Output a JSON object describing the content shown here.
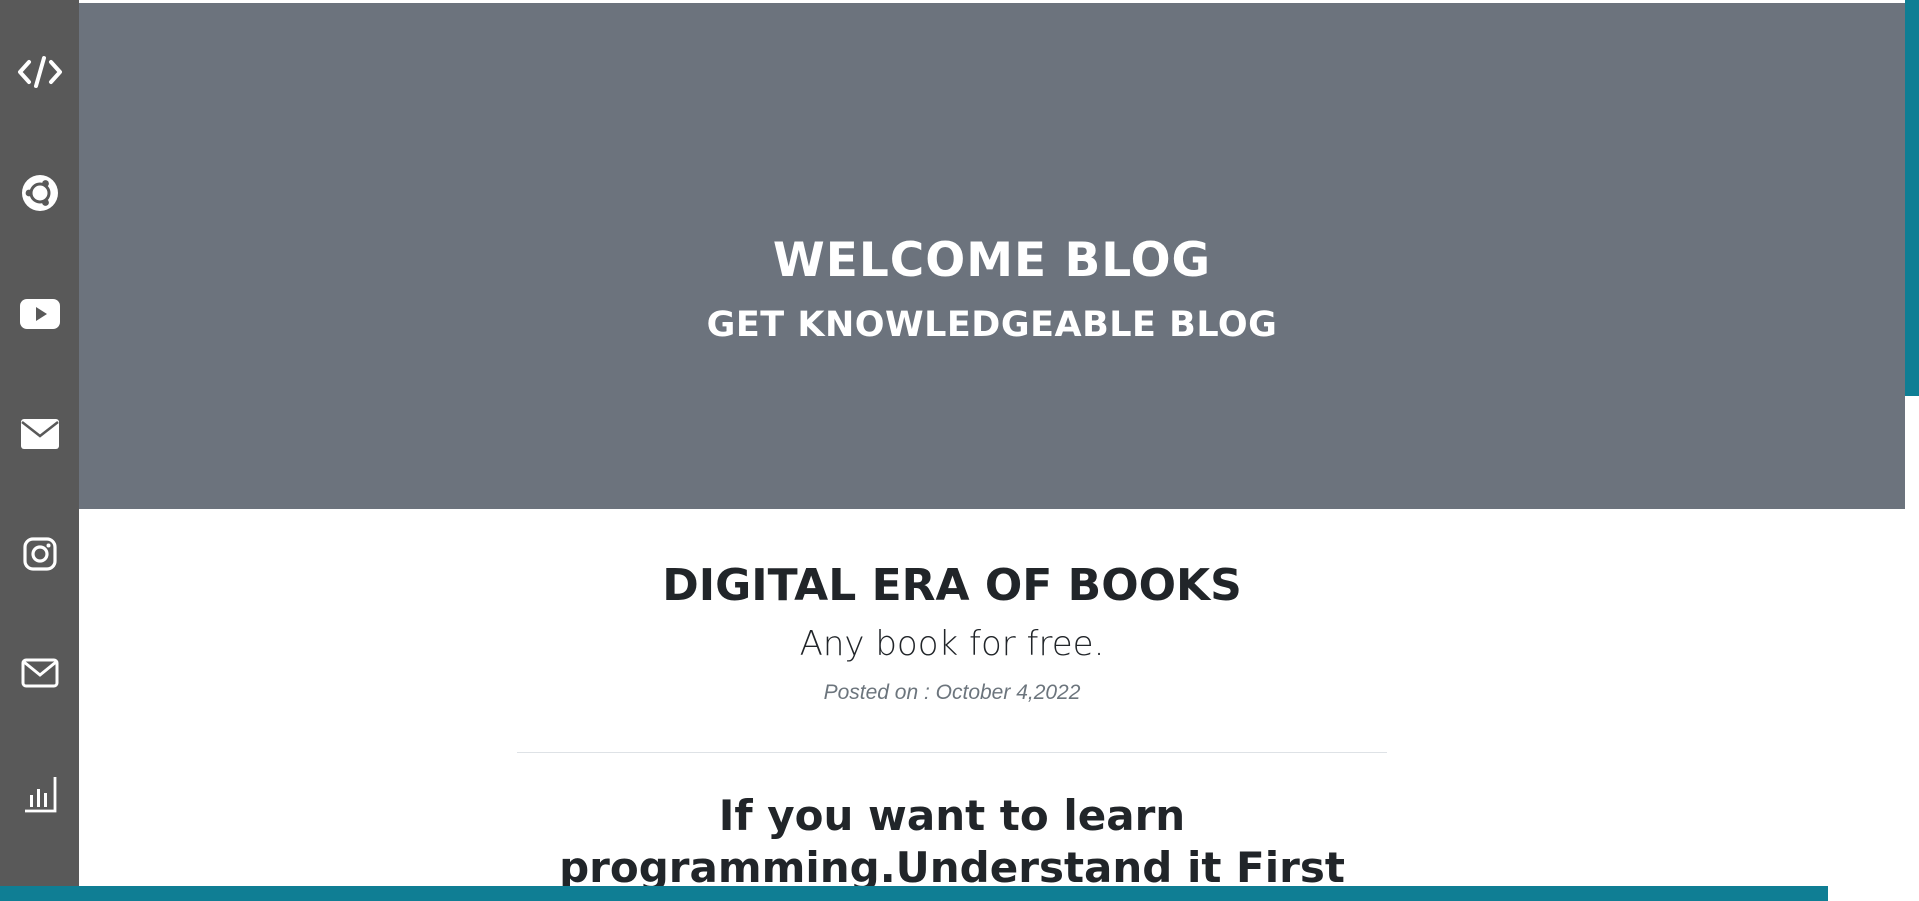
{
  "sidebar": {
    "items": [
      {
        "icon": "code-icon",
        "label": "Code"
      },
      {
        "icon": "ubuntu-icon",
        "label": "Ubuntu"
      },
      {
        "icon": "youtube-icon",
        "label": "YouTube"
      },
      {
        "icon": "mail-icon",
        "label": "Mail"
      },
      {
        "icon": "instagram-icon",
        "label": "Instagram"
      },
      {
        "icon": "envelope-outline-icon",
        "label": "Email"
      },
      {
        "icon": "bar-chart-icon",
        "label": "Stats"
      }
    ]
  },
  "hero": {
    "title": "WELCOME BLOG",
    "subtitle": "GET KNOWLEDGEABLE BLOG"
  },
  "posts": [
    {
      "title": "DIGITAL ERA OF BOOKS",
      "subtitle": "Any book for free.",
      "meta": "Posted on : October 4,2022"
    },
    {
      "title": "If you want to learn programming.Understand it First"
    }
  ],
  "colors": {
    "sidebar": "#595959",
    "hero": "#6c737d",
    "accent": "#0f7e94",
    "text": "#212529",
    "muted": "#6c757d"
  }
}
